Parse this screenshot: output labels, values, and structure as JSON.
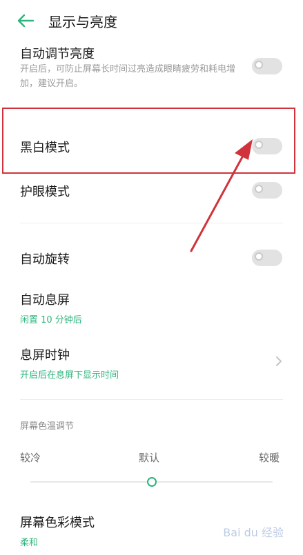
{
  "header": {
    "title": "显示与亮度",
    "back_icon": "arrow-left-icon"
  },
  "settings": {
    "auto_brightness": {
      "title": "自动调节亮度",
      "description": "开启后，可防止屏幕长时间过亮造成眼睛疲劳和耗电增加，建议开启。",
      "enabled": false
    },
    "monochrome": {
      "title": "黑白模式",
      "enabled": false
    },
    "eye_care": {
      "title": "护眼模式",
      "enabled": false
    },
    "auto_rotate": {
      "title": "自动旋转",
      "enabled": false
    },
    "screen_timeout": {
      "title": "自动息屏",
      "value": "闲置 10 分钟后"
    },
    "aod_clock": {
      "title": "息屏时钟",
      "subtitle": "开启后在息屏下显示时间"
    },
    "color_temperature": {
      "section_label": "屏幕色温调节",
      "cooler_label": "较冷",
      "default_label": "默认",
      "warmer_label": "较暖",
      "position": 0.5
    },
    "color_mode": {
      "title": "屏幕色彩模式",
      "value": "柔和"
    }
  },
  "annotation": {
    "color": "#d0333b"
  },
  "watermark": {
    "text": "Bai du 经验"
  },
  "colors": {
    "accent": "#2bb47c",
    "toggle_off": "#e2e2e2"
  }
}
